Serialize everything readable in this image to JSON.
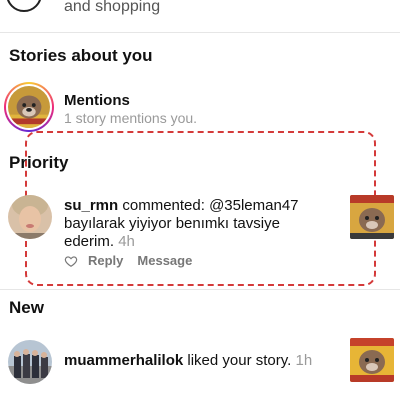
{
  "top_item": {
    "text": "and shopping"
  },
  "stories_section": {
    "title": "Stories about you",
    "mentions": {
      "title": "Mentions",
      "subtitle": "1 story mentions you."
    }
  },
  "priority_section": {
    "title": "Priority",
    "notification": {
      "username": "su_rmn",
      "message": "commented: @35leman47 bayılarak yiyiyor benımkı tavsiye ederim.",
      "time": "4h",
      "actions": {
        "reply": "Reply",
        "message": "Message"
      }
    }
  },
  "new_section": {
    "title": "New",
    "notification": {
      "username": "muammerhalilok",
      "message": "liked your story.",
      "time": "1h"
    }
  },
  "colors": {
    "dashed_border": "#d43a3a",
    "secondary_text": "#9a9a9a"
  }
}
